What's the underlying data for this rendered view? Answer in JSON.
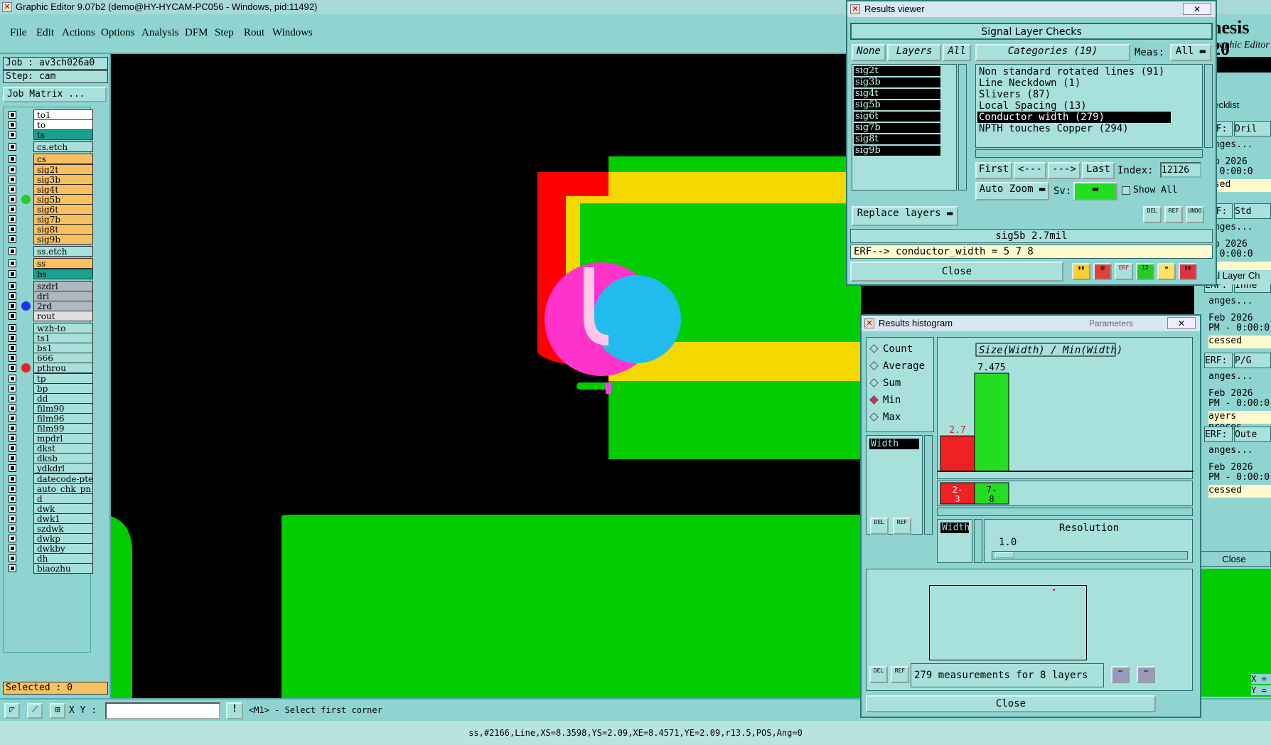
{
  "window": {
    "title": "Graphic Editor 9.07b2 (demo@HY-HYCAM-PC056 - Windows, pid:11492)"
  },
  "menu": [
    "File",
    "Edit",
    "Actions",
    "Options",
    "Analysis",
    "DFM",
    "Step",
    "Rout",
    "Windows"
  ],
  "job": {
    "job_label": "Job : av3ch026a0",
    "step_label": "Step: cam",
    "matrix_button": "Job Matrix ..."
  },
  "layers": [
    {
      "name": "to1",
      "bg": "#ffffff"
    },
    {
      "name": "to",
      "bg": "#ffffff"
    },
    {
      "name": "ts",
      "bg": "#1aa090"
    },
    {
      "name": "cs.etch",
      "bg": "#a8e0dc"
    },
    {
      "name": "cs",
      "bg": "#f8c060"
    },
    {
      "name": "sig2t",
      "bg": "#f8c060"
    },
    {
      "name": "sig3b",
      "bg": "#f8c060"
    },
    {
      "name": "sig4t",
      "bg": "#f8c060"
    },
    {
      "name": "sig5b",
      "bg": "#f8c060",
      "dot": "#22cc22"
    },
    {
      "name": "sig6t",
      "bg": "#f8c060"
    },
    {
      "name": "sig7b",
      "bg": "#f8c060"
    },
    {
      "name": "sig8t",
      "bg": "#f8c060"
    },
    {
      "name": "sig9b",
      "bg": "#f8c060"
    },
    {
      "name": "ss.etch",
      "bg": "#a8e0dc"
    },
    {
      "name": "ss",
      "bg": "#f8c060"
    },
    {
      "name": "bs",
      "bg": "#1aa090"
    },
    {
      "name": "szdrl",
      "bg": "#b0b8c0"
    },
    {
      "name": "drl",
      "bg": "#b0b8c0"
    },
    {
      "name": "2rd",
      "bg": "#b0b8c0",
      "dot": "#2233ee"
    },
    {
      "name": "rout",
      "bg": "#e0e0e0"
    },
    {
      "name": "wzh-to",
      "bg": "#a8e0dc"
    },
    {
      "name": "ts1",
      "bg": "#a8e0dc"
    },
    {
      "name": "bs1",
      "bg": "#a8e0dc"
    },
    {
      "name": "666",
      "bg": "#a8e0dc"
    },
    {
      "name": "pthrou",
      "bg": "#a8e0dc",
      "dot": "#ee2222"
    },
    {
      "name": "tp",
      "bg": "#a8e0dc"
    },
    {
      "name": "bp",
      "bg": "#a8e0dc"
    },
    {
      "name": "dd",
      "bg": "#a8e0dc"
    },
    {
      "name": "film90",
      "bg": "#a8e0dc"
    },
    {
      "name": "film96",
      "bg": "#a8e0dc"
    },
    {
      "name": "film99",
      "bg": "#a8e0dc"
    },
    {
      "name": "mpdrl",
      "bg": "#a8e0dc"
    },
    {
      "name": "dkst",
      "bg": "#a8e0dc"
    },
    {
      "name": "dksb",
      "bg": "#a8e0dc"
    },
    {
      "name": "ydkdrl",
      "bg": "#a8e0dc"
    },
    {
      "name": "datecode-pte",
      "bg": "#a8e0dc"
    },
    {
      "name": "auto_chk_pn",
      "bg": "#a8e0dc"
    },
    {
      "name": "d",
      "bg": "#a8e0dc"
    },
    {
      "name": "dwk",
      "bg": "#a8e0dc"
    },
    {
      "name": "dwk1",
      "bg": "#a8e0dc"
    },
    {
      "name": "szdwk",
      "bg": "#a8e0dc"
    },
    {
      "name": "dwkp",
      "bg": "#a8e0dc"
    },
    {
      "name": "dwkby",
      "bg": "#a8e0dc"
    },
    {
      "name": "dh",
      "bg": "#a8e0dc"
    },
    {
      "name": "biaozhu",
      "bg": "#a8e0dc"
    }
  ],
  "selected": "Selected : 0",
  "bottom": {
    "xy_label": "X Y :",
    "xy_value": "",
    "prompt": "<M1> - Select first corner"
  },
  "status": "ss,#2166,Line,XS=8.3598,YS=2.09,XE=8.4571,YE=2.09,r13.5,POS,Ang=0",
  "results_viewer": {
    "title": "Results viewer",
    "close_x": "✕",
    "header": "Signal Layer Checks",
    "none_btn": "None",
    "layers_btn": "Layers",
    "all_btn": "All",
    "layer_items": [
      "sig2t",
      "sig3b",
      "sig4t",
      "sig5b",
      "sig6t",
      "sig7b",
      "sig8t",
      "sig9b"
    ],
    "categories_label": "Categories (19)",
    "meas_label": "Meas:",
    "meas_value": "All",
    "categories": [
      "Non standard rotated lines (91)",
      "Line Neckdown (1)",
      "Slivers (87)",
      "Local Spacing (13)",
      "Conductor width (279)",
      "NPTH touches Copper (294)"
    ],
    "selected_category": 4,
    "first_btn": "First",
    "prev_btn": "<---",
    "next_btn": "--->",
    "last_btn": "Last",
    "index_label": "Index:",
    "index_value": "12126",
    "autozoom": "Auto Zoom",
    "sv_label": "Sv:",
    "show_all": "Show All",
    "replace_layers": "Replace layers",
    "del": "DEL",
    "ref": "REF",
    "undo": "UNDO",
    "info_line": "sig5b 2.7mil",
    "erf_line": "ERF--> conductor_width = 5 7 8",
    "close": "Close"
  },
  "histogram": {
    "title": "Results histogram",
    "params": "Parameters",
    "close_x": "✕",
    "radios": [
      "Count",
      "Average",
      "Sum",
      "Min",
      "Max"
    ],
    "selected_radio": 3,
    "field": "Width",
    "chart_title": "Size(Width) / Min(Width)",
    "bars": [
      {
        "label": "2-\n3",
        "value": 2.7,
        "color": "#ee2222",
        "value_label": "2.7"
      },
      {
        "label": "7-\n8",
        "value": 7.475,
        "color": "#22dd22",
        "value_label": "7.475"
      }
    ],
    "ymax": 7.475,
    "res_field": "Width",
    "resolution_label": "Resolution",
    "resolution_value": "1.0",
    "del": "DEL",
    "ref": "REF",
    "measurements": "279 measurements for 8 layers",
    "close": "Close"
  },
  "right_fragment": {
    "brand": "nesis 20",
    "sub": "raphic Editor",
    "checklist": "hecklist",
    "rows": [
      {
        "erf": "ERF:",
        "val": "Dril",
        "ch": "anges...",
        "date": "eb 2026",
        "time": " - 0:00:0",
        "state": "ssed"
      },
      {
        "erf": "ERF:",
        "val": "Std",
        "ch": "anges...",
        "date": "eb 2026",
        "time": " - 0:00:0",
        "state": ""
      },
      {
        "erf": "ERF:",
        "val": "Inne",
        "ch": "anges...",
        "date": "Feb 2026",
        "time": "PM - 0:00:0",
        "state": "cessed"
      },
      {
        "erf": "ERF:",
        "val": "P/G",
        "ch": "anges...",
        "date": "Feb 2026",
        "time": "PM - 0:00:0",
        "state": "ayers proces"
      },
      {
        "erf": "ERF:",
        "val": "Oute",
        "ch": "anges...",
        "date": "Feb 2026",
        "time": "PM - 0:00:0",
        "state": "cessed"
      }
    ],
    "signal_item": "Signal Layer Ch",
    "close": "Close",
    "x_label": "X =",
    "y_label": "Y ="
  }
}
